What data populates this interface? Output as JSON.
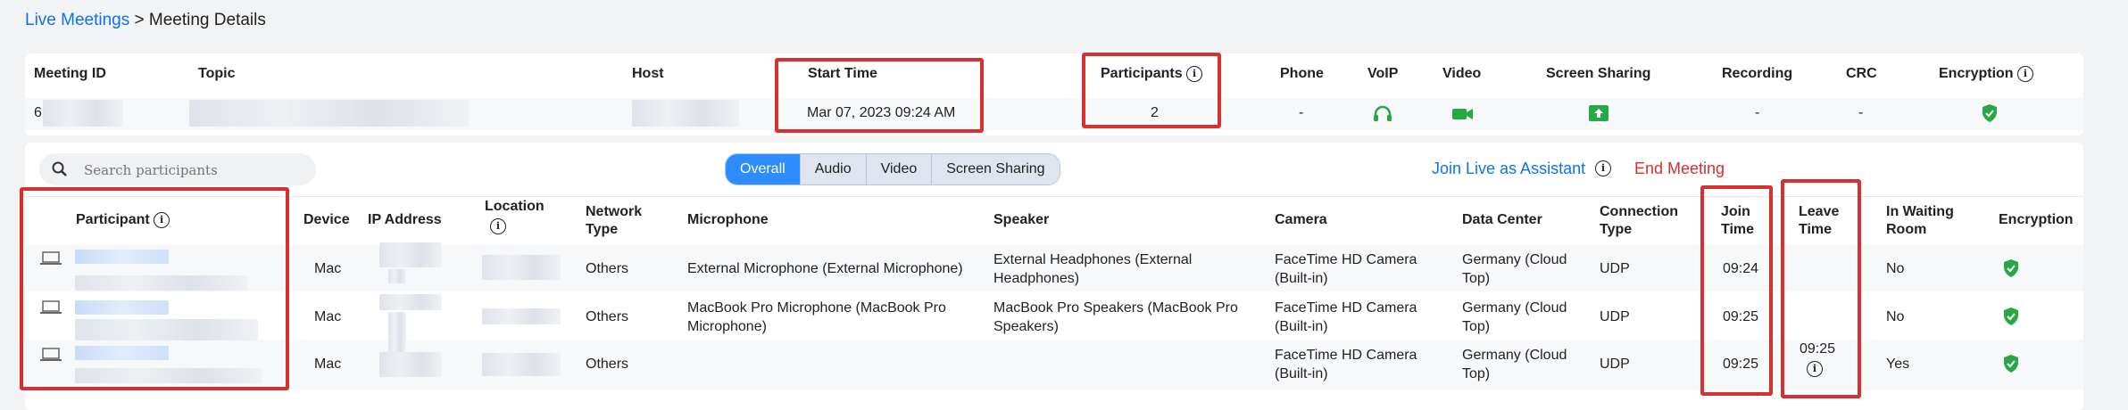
{
  "breadcrumb": {
    "link": "Live Meetings",
    "sep": ">",
    "current": "Meeting Details"
  },
  "meeting": {
    "headers": {
      "id": "Meeting ID",
      "topic": "Topic",
      "host": "Host",
      "start": "Start Time",
      "participants": "Participants",
      "phone": "Phone",
      "voip": "VoIP",
      "video": "Video",
      "screen_sharing": "Screen Sharing",
      "recording": "Recording",
      "crc": "CRC",
      "encryption": "Encryption"
    },
    "values": {
      "id_prefix": "6",
      "start": "Mar 07, 2023 09:24 AM",
      "participants": "2",
      "phone": "-",
      "recording": "-",
      "crc": "-"
    }
  },
  "search": {
    "placeholder": "Search participants"
  },
  "tabs": [
    "Overall",
    "Audio",
    "Video",
    "Screen Sharing"
  ],
  "active_tab": "Overall",
  "actions": {
    "join_assistant": "Join Live as Assistant",
    "end_meeting": "End Meeting"
  },
  "table": {
    "headers": {
      "participant": "Participant",
      "device": "Device",
      "ip": "IP Address",
      "location_line1": "Location",
      "network_line1": "Network",
      "network_line2": "Type",
      "microphone": "Microphone",
      "speaker": "Speaker",
      "camera": "Camera",
      "dc": "Data Center",
      "conn_line1": "Connection",
      "conn_line2": "Type",
      "join_line1": "Join",
      "join_line2": "Time",
      "leave_line1": "Leave",
      "leave_line2": "Time",
      "wait_line1": "In Waiting",
      "wait_line2": "Room",
      "encryption": "Encryption"
    },
    "rows": [
      {
        "device": "Mac",
        "network": "Others",
        "mic_l1": "External Microphone (External Microphone)",
        "mic_l2": "",
        "spk_l1": "External Headphones (External",
        "spk_l2": "Headphones)",
        "cam_l1": "FaceTime HD Camera",
        "cam_l2": "(Built-in)",
        "dc_l1": "Germany (Cloud",
        "dc_l2": "Top)",
        "conn": "UDP",
        "join": "09:24",
        "leave": "",
        "waiting": "No"
      },
      {
        "device": "Mac",
        "network": "Others",
        "mic_l1": "MacBook Pro Microphone (MacBook Pro",
        "mic_l2": "Microphone)",
        "spk_l1": "MacBook Pro Speakers (MacBook Pro",
        "spk_l2": "Speakers)",
        "cam_l1": "FaceTime HD Camera",
        "cam_l2": "(Built-in)",
        "dc_l1": "Germany (Cloud",
        "dc_l2": "Top)",
        "conn": "UDP",
        "join": "09:25",
        "leave": "",
        "waiting": "No"
      },
      {
        "device": "Mac",
        "network": "Others",
        "mic_l1": "",
        "mic_l2": "",
        "spk_l1": "",
        "spk_l2": "",
        "cam_l1": "FaceTime HD Camera",
        "cam_l2": "(Built-in)",
        "dc_l1": "Germany (Cloud",
        "dc_l2": "Top)",
        "conn": "UDP",
        "join": "09:25",
        "leave": "09:25",
        "waiting": "Yes"
      }
    ]
  },
  "colors": {
    "accent": "#0e72ed",
    "danger": "#d63031",
    "success": "#27a745",
    "tab_active": "#2d8cff",
    "highlight": "#d63031"
  },
  "icons": {
    "info": "info-icon",
    "voip": "headset-icon",
    "video": "video-camera-icon",
    "screen_sharing": "screen-share-icon",
    "encryption": "shield-check-icon",
    "search": "search-icon",
    "device": "laptop-icon"
  }
}
